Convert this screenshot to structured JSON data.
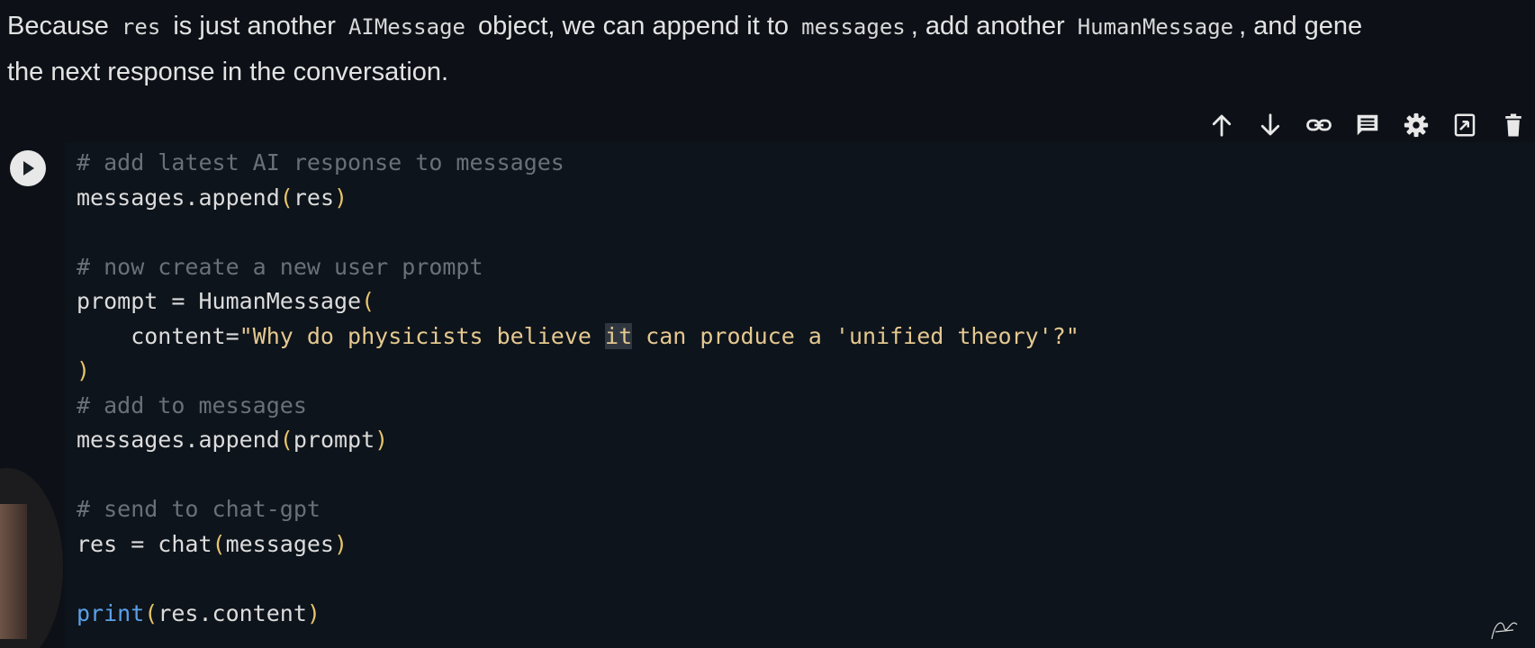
{
  "markdown": {
    "t1": "Because ",
    "c1": "res",
    "t2": " is just another ",
    "c2": "AIMessage",
    "t3": " object, we can append it to ",
    "c3": "messages",
    "t4": ", add another ",
    "c4": "HumanMessage",
    "t5": ", and gene",
    "line2": "the next response in the conversation."
  },
  "toolbar": {
    "icons": [
      "arrow-up-icon",
      "arrow-down-icon",
      "link-icon",
      "comment-icon",
      "gear-icon",
      "mirror-cell-icon",
      "trash-icon"
    ]
  },
  "code": {
    "l1": "# add latest AI response to messages",
    "l2a": "messages.append",
    "l2b": "(",
    "l2c": "res",
    "l2d": ")",
    "l4": "# now create a new user prompt",
    "l5a": "prompt = HumanMessage",
    "l5b": "(",
    "l6a": "    content=",
    "l6b": "\"Why do physicists believe ",
    "l6c": "it",
    "l6d": " can produce a 'unified theory'?\"",
    "l7": ")",
    "l8": "# add to messages",
    "l9a": "messages.append",
    "l9b": "(",
    "l9c": "prompt",
    "l9d": ")",
    "l11": "# send to chat-gpt",
    "l12a": "res = chat",
    "l12b": "(",
    "l12c": "messages",
    "l12d": ")",
    "l14a": "print",
    "l14b": "(",
    "l14c": "res.content",
    "l14d": ")"
  },
  "colors": {
    "background": "#0d1117",
    "comment": "#6b7078",
    "paren": "#e7c46a",
    "string": "#e4c890",
    "builtin": "#5aa0e8"
  }
}
